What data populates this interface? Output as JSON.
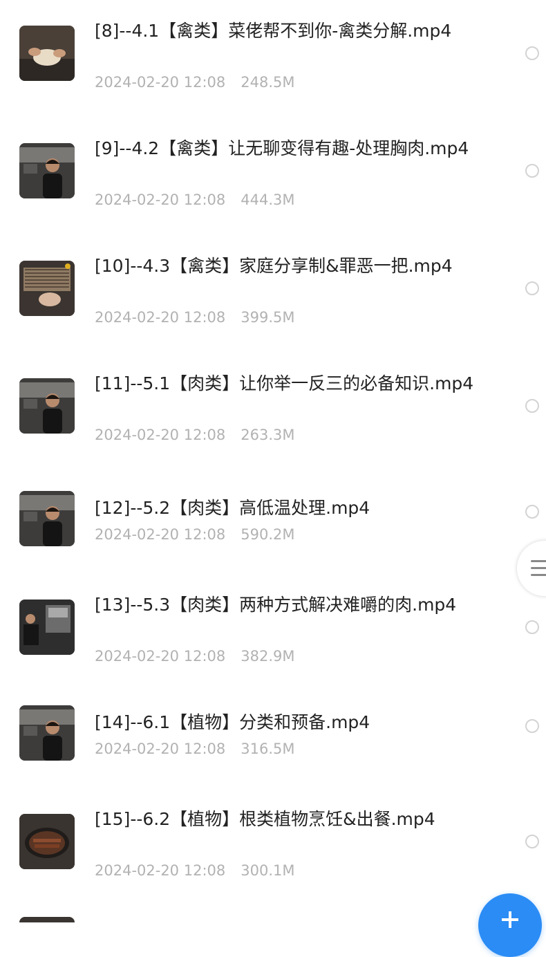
{
  "files": [
    {
      "name": "[8]--4.1【禽类】菜佬帮不到你-禽类分解.mp4",
      "date": "2024-02-20 12:08",
      "size": "248.5M",
      "thumb_icon": "video-thumbnail-poultry-prep"
    },
    {
      "name": "[9]--4.2【禽类】让无聊变得有趣-处理胸肉.mp4",
      "date": "2024-02-20 12:08",
      "size": "444.3M",
      "thumb_icon": "video-thumbnail-chef"
    },
    {
      "name": "[10]--4.3【禽类】家庭分享制&罪恶一把.mp4",
      "date": "2024-02-20 12:08",
      "size": "399.5M",
      "thumb_icon": "video-thumbnail-oven-tray"
    },
    {
      "name": "[11]--5.1【肉类】让你举一反三的必备知识.mp4",
      "date": "2024-02-20 12:08",
      "size": "263.3M",
      "thumb_icon": "video-thumbnail-chef"
    },
    {
      "name": "[12]--5.2【肉类】高低温处理.mp4",
      "date": "2024-02-20 12:08",
      "size": "590.2M",
      "thumb_icon": "video-thumbnail-chef"
    },
    {
      "name": "[13]--5.3【肉类】两种方式解决难嚼的肉.mp4",
      "date": "2024-02-20 12:08",
      "size": "382.9M",
      "thumb_icon": "video-thumbnail-kitchen"
    },
    {
      "name": "[14]--6.1【植物】分类和预备.mp4",
      "date": "2024-02-20 12:08",
      "size": "316.5M",
      "thumb_icon": "video-thumbnail-chef"
    },
    {
      "name": "[15]--6.2【植物】根类植物烹饪&出餐.mp4",
      "date": "2024-02-20 12:08",
      "size": "300.1M",
      "thumb_icon": "video-thumbnail-pan"
    }
  ],
  "icons": {
    "select": "radio-circle-icon",
    "side_menu": "menu-lines-icon",
    "fab": "plus-icon"
  },
  "colors": {
    "title_text": "#222222",
    "meta_text": "#b2b2b2",
    "radio_border": "#d3d3d3",
    "fab_blue": "#2b8cf5"
  }
}
